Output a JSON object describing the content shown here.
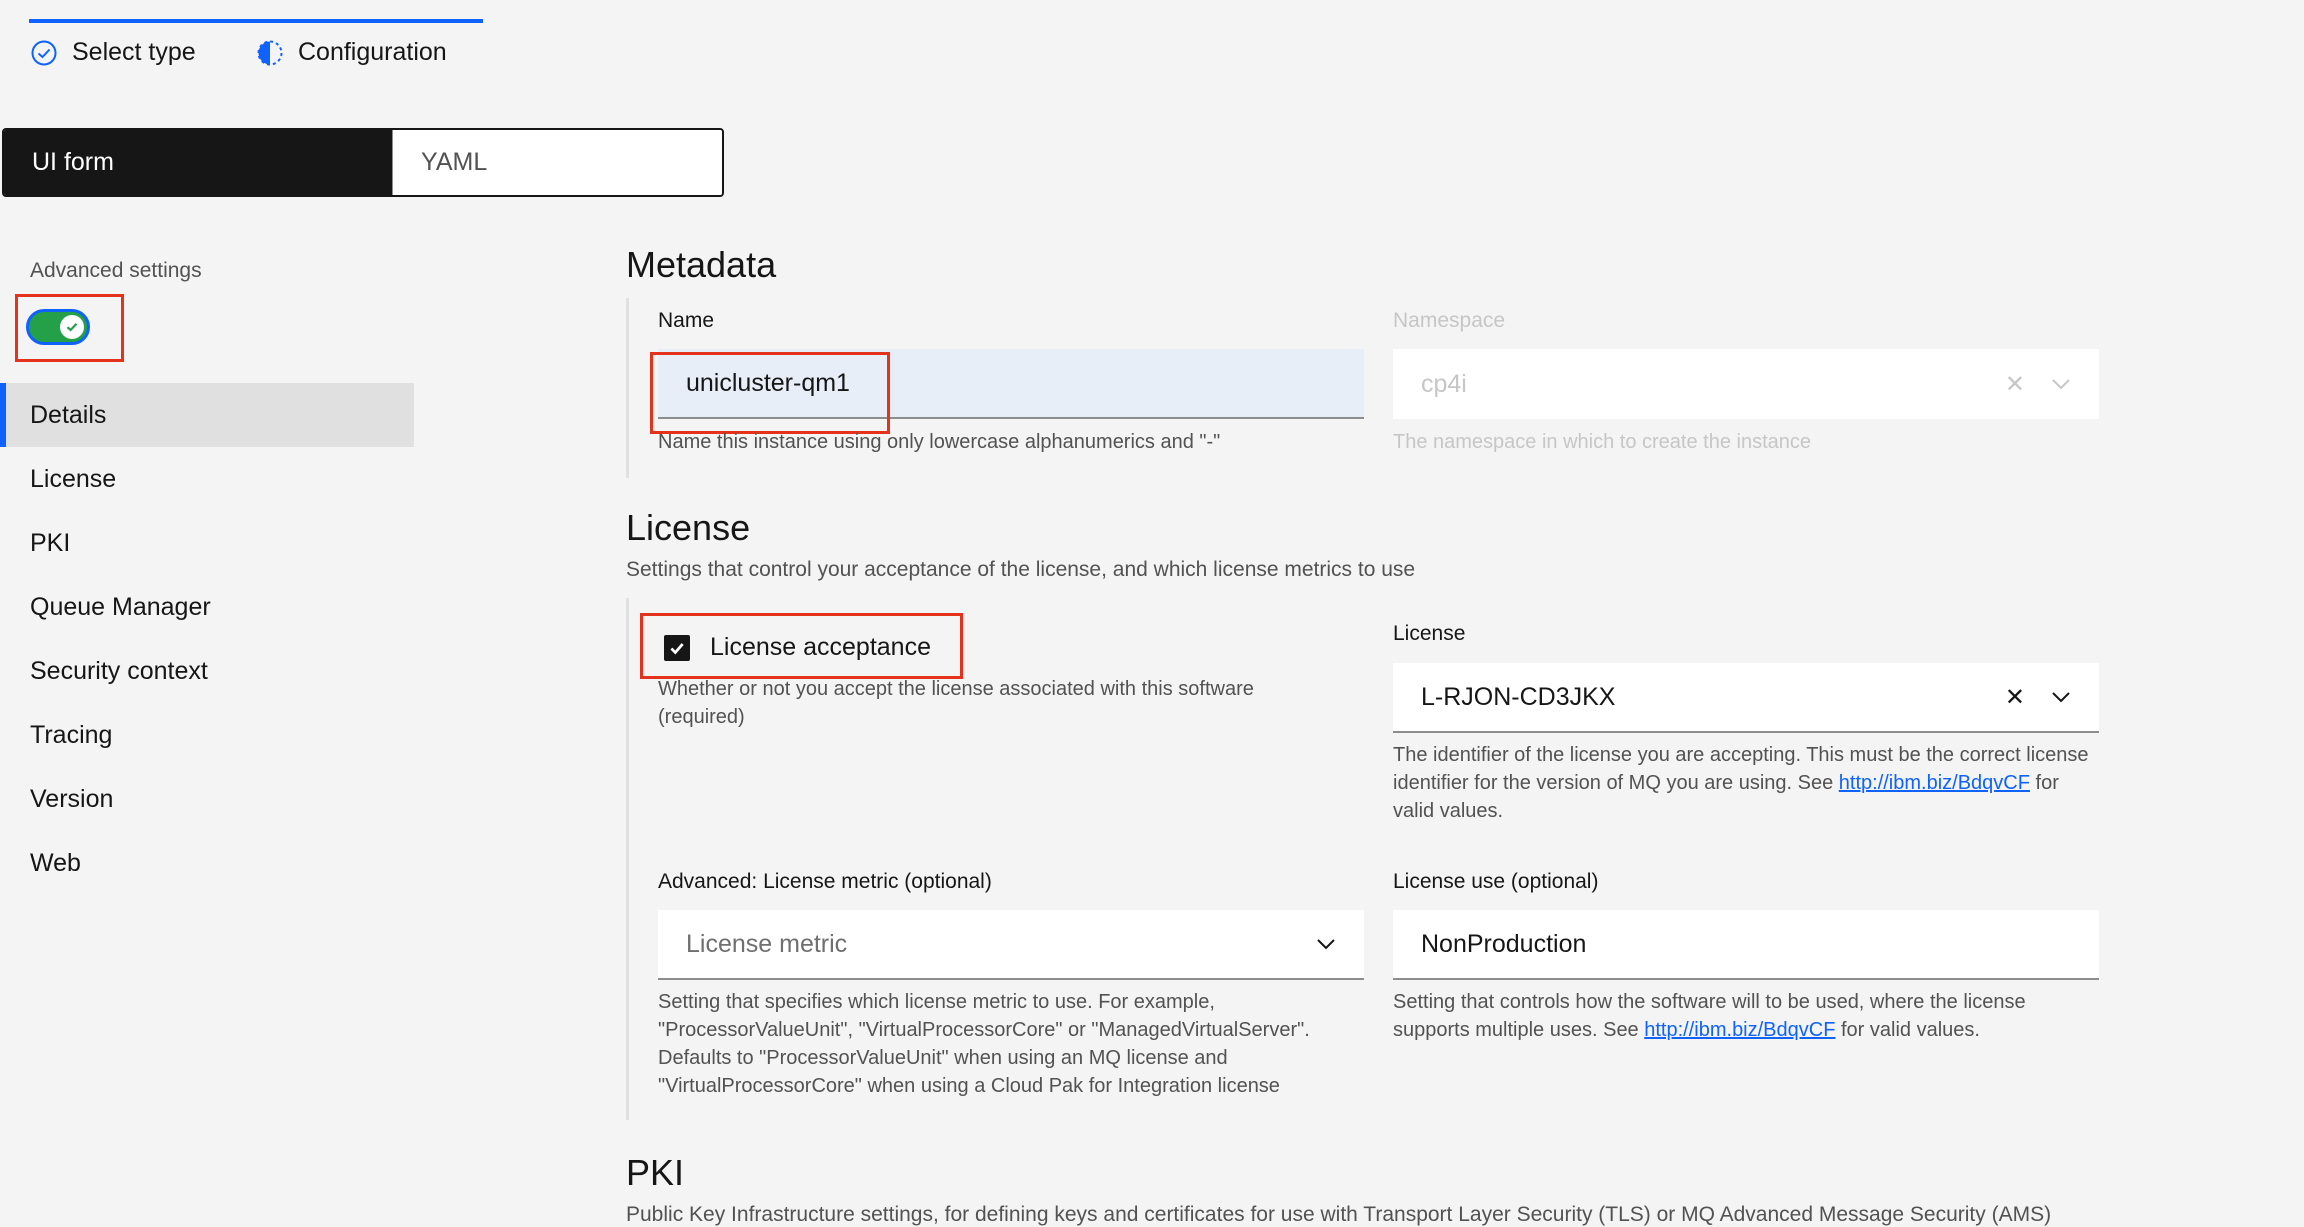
{
  "progress": {
    "steps": [
      {
        "label": "Select type",
        "icon": "checkmark-outline-icon"
      },
      {
        "label": "Configuration",
        "icon": "incomplete-icon"
      }
    ]
  },
  "switcher": {
    "ui_form": "UI form",
    "yaml": "YAML"
  },
  "sidebar": {
    "advanced_settings_label": "Advanced settings",
    "advanced_settings_on": true,
    "items": [
      {
        "label": "Details",
        "selected": true
      },
      {
        "label": "License"
      },
      {
        "label": "PKI"
      },
      {
        "label": "Queue Manager"
      },
      {
        "label": "Security context"
      },
      {
        "label": "Tracing"
      },
      {
        "label": "Version"
      },
      {
        "label": "Web"
      }
    ]
  },
  "metadata": {
    "title": "Metadata",
    "name_label": "Name",
    "name_value": "unicluster-qm1",
    "name_helper": "Name this instance using only lowercase alphanumerics and \"-\"",
    "namespace_label": "Namespace",
    "namespace_value": "cp4i",
    "namespace_helper": "The namespace in which to create the instance"
  },
  "license": {
    "title": "License",
    "description": "Settings that control your acceptance of the license, and which license metrics to use",
    "acceptance_label": "License acceptance",
    "acceptance_checked": true,
    "acceptance_helper": "Whether or not you accept the license associated with this software (required)",
    "license_label": "License",
    "license_value": "L-RJON-CD3JKX",
    "license_helper_pre": "The identifier of the license you are accepting. This must be the correct license identifier for the version of MQ you are using. See ",
    "license_helper_link": "http://ibm.biz/BdqvCF",
    "license_helper_post": " for valid values.",
    "metric_label": "Advanced: License metric (optional)",
    "metric_placeholder": "License metric",
    "metric_helper": "Setting that specifies which license metric to use. For example, \"ProcessorValueUnit\", \"VirtualProcessorCore\" or \"ManagedVirtualServer\". Defaults to \"ProcessorValueUnit\" when using an MQ license and \"VirtualProcessorCore\" when using a Cloud Pak for Integration license",
    "use_label": "License use (optional)",
    "use_value": "NonProduction",
    "use_helper_pre": "Setting that controls how the software will to be used, where the license supports multiple uses. See ",
    "use_helper_link": "http://ibm.biz/BdqvCF",
    "use_helper_post": " for valid values."
  },
  "pki": {
    "title": "PKI",
    "description": "Public Key Infrastructure settings, for defining keys and certificates for use with Transport Layer Security (TLS) or MQ Advanced Message Security (AMS)"
  },
  "colors": {
    "accent": "#0f62fe",
    "highlight": "#e4321c",
    "toggle_on": "#24a148"
  }
}
